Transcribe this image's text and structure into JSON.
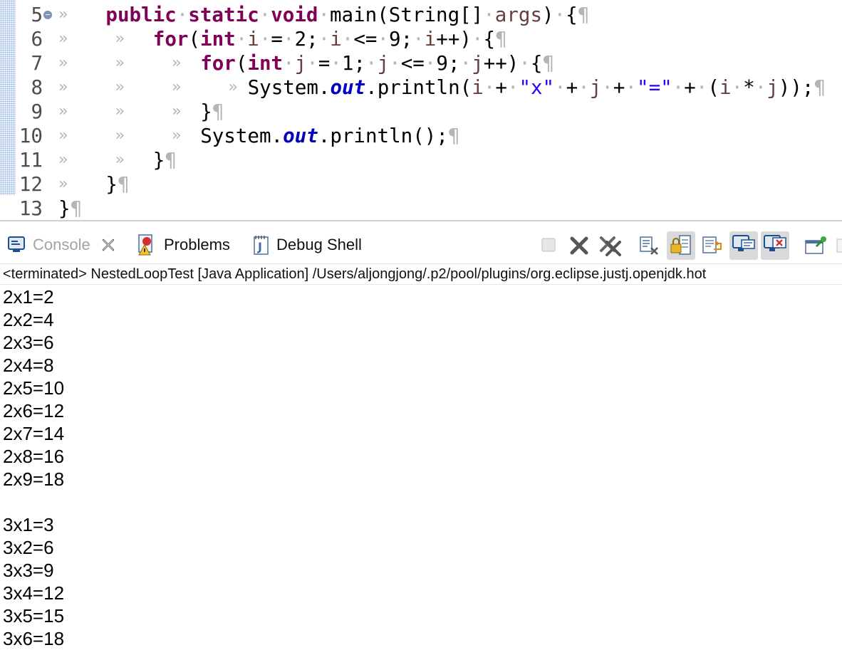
{
  "editor": {
    "lines": [
      {
        "num": "5",
        "fold": "−",
        "indent": "» ",
        "tokens": [
          {
            "t": "kw",
            "v": "public"
          },
          {
            "t": "ws",
            "v": "·"
          },
          {
            "t": "kw",
            "v": "static"
          },
          {
            "t": "ws",
            "v": "·"
          },
          {
            "t": "kw",
            "v": "void"
          },
          {
            "t": "ws",
            "v": "·"
          },
          {
            "t": "p",
            "v": "main(String[]"
          },
          {
            "t": "ws",
            "v": "·"
          },
          {
            "t": "var",
            "v": "args"
          },
          {
            "t": "p",
            "v": ")"
          },
          {
            "t": "ws",
            "v": "·"
          },
          {
            "t": "p",
            "v": "{"
          },
          {
            "t": "ws",
            "v": "¶"
          }
        ]
      },
      {
        "num": "6",
        "indent": "» » ",
        "tokens": [
          {
            "t": "kw",
            "v": "for"
          },
          {
            "t": "p",
            "v": "("
          },
          {
            "t": "kw",
            "v": "int"
          },
          {
            "t": "ws",
            "v": "·"
          },
          {
            "t": "var",
            "v": "i"
          },
          {
            "t": "ws",
            "v": "·"
          },
          {
            "t": "p",
            "v": "="
          },
          {
            "t": "ws",
            "v": "·"
          },
          {
            "t": "p",
            "v": "2;"
          },
          {
            "t": "ws",
            "v": "·"
          },
          {
            "t": "var",
            "v": "i"
          },
          {
            "t": "ws",
            "v": "·"
          },
          {
            "t": "p",
            "v": "<="
          },
          {
            "t": "ws",
            "v": "·"
          },
          {
            "t": "p",
            "v": "9;"
          },
          {
            "t": "ws",
            "v": "·"
          },
          {
            "t": "var",
            "v": "i"
          },
          {
            "t": "p",
            "v": "++)"
          },
          {
            "t": "ws",
            "v": "·"
          },
          {
            "t": "p",
            "v": "{"
          },
          {
            "t": "ws",
            "v": "¶"
          }
        ]
      },
      {
        "num": "7",
        "indent": "» » » ",
        "tokens": [
          {
            "t": "kw",
            "v": "for"
          },
          {
            "t": "p",
            "v": "("
          },
          {
            "t": "kw",
            "v": "int"
          },
          {
            "t": "ws",
            "v": "·"
          },
          {
            "t": "var",
            "v": "j"
          },
          {
            "t": "ws",
            "v": "·"
          },
          {
            "t": "p",
            "v": "="
          },
          {
            "t": "ws",
            "v": "·"
          },
          {
            "t": "p",
            "v": "1;"
          },
          {
            "t": "ws",
            "v": "·"
          },
          {
            "t": "var",
            "v": "j"
          },
          {
            "t": "ws",
            "v": "·"
          },
          {
            "t": "p",
            "v": "<="
          },
          {
            "t": "ws",
            "v": "·"
          },
          {
            "t": "p",
            "v": "9;"
          },
          {
            "t": "ws",
            "v": "·"
          },
          {
            "t": "var",
            "v": "j"
          },
          {
            "t": "p",
            "v": "++)"
          },
          {
            "t": "ws",
            "v": "·"
          },
          {
            "t": "p",
            "v": "{"
          },
          {
            "t": "ws",
            "v": "¶"
          }
        ]
      },
      {
        "num": "8",
        "indent": "» » » » ",
        "tokens": [
          {
            "t": "p",
            "v": "System."
          },
          {
            "t": "fld",
            "v": "out"
          },
          {
            "t": "p",
            "v": ".println("
          },
          {
            "t": "var",
            "v": "i"
          },
          {
            "t": "ws",
            "v": "·"
          },
          {
            "t": "p",
            "v": "+"
          },
          {
            "t": "ws",
            "v": "·"
          },
          {
            "t": "str",
            "v": "\"x\""
          },
          {
            "t": "ws",
            "v": "·"
          },
          {
            "t": "p",
            "v": "+"
          },
          {
            "t": "ws",
            "v": "·"
          },
          {
            "t": "var",
            "v": "j"
          },
          {
            "t": "ws",
            "v": "·"
          },
          {
            "t": "p",
            "v": "+"
          },
          {
            "t": "ws",
            "v": "·"
          },
          {
            "t": "str",
            "v": "\"=\""
          },
          {
            "t": "ws",
            "v": "·"
          },
          {
            "t": "p",
            "v": "+"
          },
          {
            "t": "ws",
            "v": "·"
          },
          {
            "t": "p",
            "v": "("
          },
          {
            "t": "var",
            "v": "i"
          },
          {
            "t": "ws",
            "v": "·"
          },
          {
            "t": "p",
            "v": "*"
          },
          {
            "t": "ws",
            "v": "·"
          },
          {
            "t": "var",
            "v": "j"
          },
          {
            "t": "p",
            "v": "));"
          },
          {
            "t": "ws",
            "v": "¶"
          }
        ]
      },
      {
        "num": "9",
        "indent": "» » » ",
        "tokens": [
          {
            "t": "p",
            "v": "}"
          },
          {
            "t": "ws",
            "v": "¶"
          }
        ]
      },
      {
        "num": "10",
        "indent": "» » » ",
        "tokens": [
          {
            "t": "p",
            "v": "System."
          },
          {
            "t": "fld",
            "v": "out"
          },
          {
            "t": "p",
            "v": ".println();"
          },
          {
            "t": "ws",
            "v": "¶"
          }
        ]
      },
      {
        "num": "11",
        "indent": "» » ",
        "tokens": [
          {
            "t": "p",
            "v": "}"
          },
          {
            "t": "ws",
            "v": "¶"
          }
        ]
      },
      {
        "num": "12",
        "indent": "» ",
        "tokens": [
          {
            "t": "p",
            "v": "}"
          },
          {
            "t": "ws",
            "v": "¶"
          }
        ]
      },
      {
        "num": "13",
        "indent": "",
        "tokens": [
          {
            "t": "p",
            "v": "}"
          },
          {
            "t": "ws",
            "v": "¶"
          }
        ]
      }
    ]
  },
  "console_view": {
    "tabs": [
      {
        "label": "Console",
        "icon": "console-icon",
        "active": true
      },
      {
        "label": "Problems",
        "icon": "problems-icon",
        "active": false
      },
      {
        "label": "Debug Shell",
        "icon": "debug-shell-icon",
        "active": false
      }
    ],
    "toolbar": [
      "terminate-icon",
      "remove-launch-icon",
      "remove-all-terminated-icon",
      "clear-console-icon",
      "scroll-lock-icon",
      "word-wrap-icon",
      "show-on-stdout-icon",
      "show-on-stderr-icon",
      "pin-console-icon"
    ],
    "status": "<terminated> NestedLoopTest [Java Application] /Users/aljongjong/.p2/pool/plugins/org.eclipse.justj.openjdk.hot",
    "output": [
      "2x1=2",
      "2x2=4",
      "2x3=6",
      "2x4=8",
      "2x5=10",
      "2x6=12",
      "2x7=14",
      "2x8=16",
      "2x9=18",
      "",
      "3x1=3",
      "3x2=6",
      "3x3=9",
      "3x4=12",
      "3x5=15",
      "3x6=18"
    ]
  },
  "colors": {
    "keyword": "#7f0055",
    "field": "#0000c0",
    "string": "#2a00ff",
    "variable": "#6a3e3e",
    "whitespace": "#b5b5b5"
  }
}
